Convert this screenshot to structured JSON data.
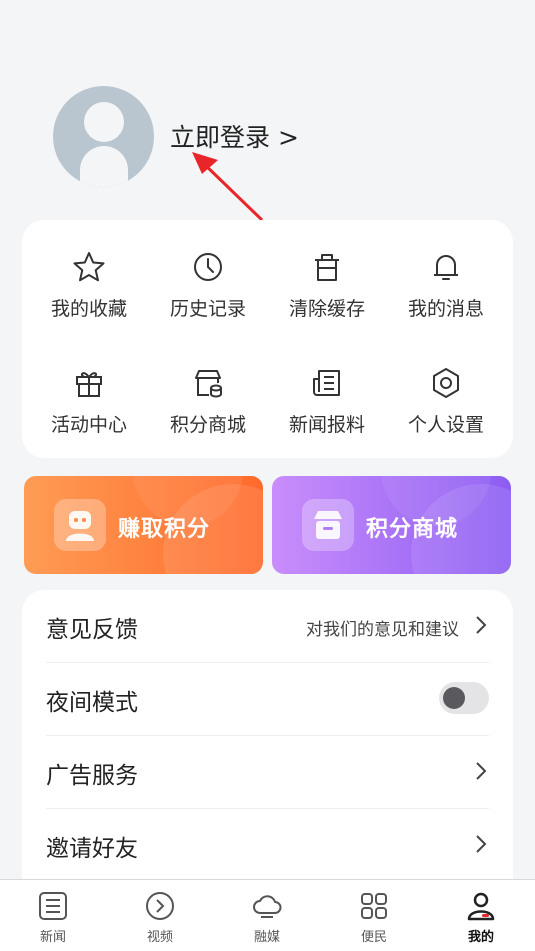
{
  "profile": {
    "login_text": "立即登录 >"
  },
  "grid": {
    "items": [
      {
        "label": "我的收藏",
        "icon": "star-icon"
      },
      {
        "label": "历史记录",
        "icon": "clock-icon"
      },
      {
        "label": "清除缓存",
        "icon": "trash-icon"
      },
      {
        "label": "我的消息",
        "icon": "bell-icon"
      },
      {
        "label": "活动中心",
        "icon": "gift-icon"
      },
      {
        "label": "积分商城",
        "icon": "store-coins-icon"
      },
      {
        "label": "新闻报料",
        "icon": "news-icon"
      },
      {
        "label": "个人设置",
        "icon": "settings-hex-icon"
      }
    ]
  },
  "banners": {
    "earn_points": "赚取积分",
    "points_mall": "积分商城"
  },
  "settings": {
    "feedback": {
      "label": "意见反馈",
      "hint": "对我们的意见和建议"
    },
    "night_mode": {
      "label": "夜间模式",
      "enabled": false
    },
    "ad_service": {
      "label": "广告服务"
    },
    "invite": {
      "label": "邀请好友"
    }
  },
  "tabbar": {
    "tabs": [
      {
        "label": "新闻",
        "icon": "news-list-icon"
      },
      {
        "label": "视频",
        "icon": "play-circle-icon"
      },
      {
        "label": "融媒",
        "icon": "cloud-icon"
      },
      {
        "label": "便民",
        "icon": "grid-apps-icon"
      },
      {
        "label": "我的",
        "icon": "user-icon",
        "active": true
      }
    ]
  },
  "colors": {
    "annotation_arrow": "#e8262a",
    "earn_banner": "#ff7a35",
    "mall_banner": "#a574f7",
    "active_tab_accent": "#e8262a"
  }
}
